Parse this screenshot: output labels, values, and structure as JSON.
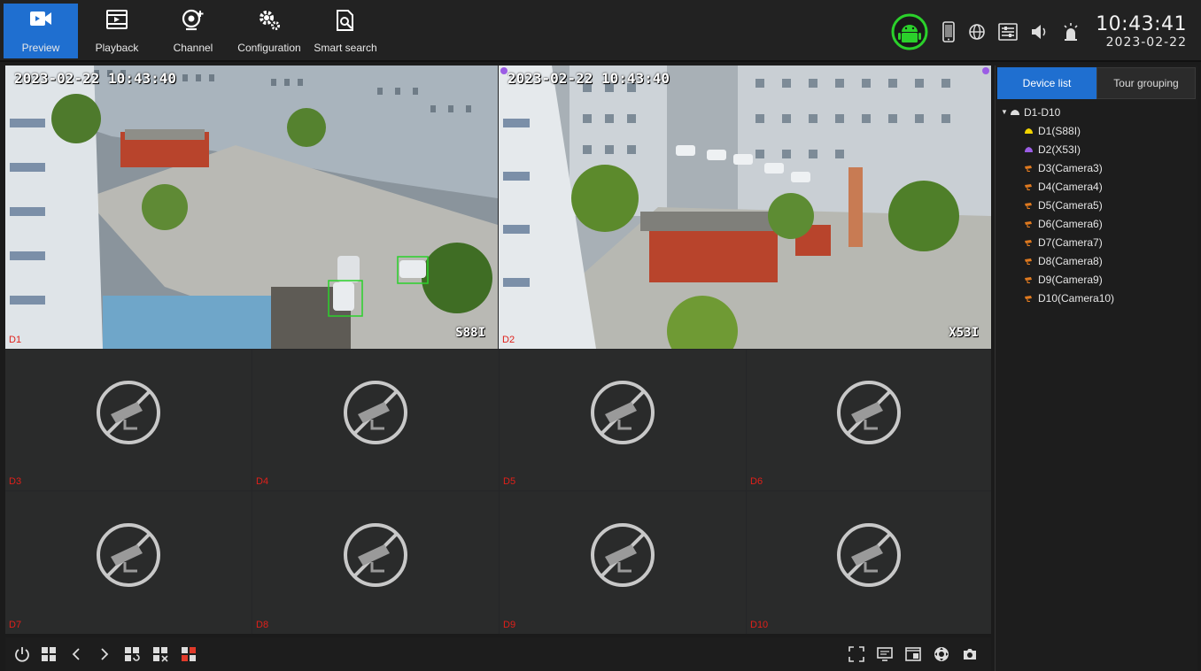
{
  "topnav": {
    "items": [
      {
        "label": "Preview",
        "icon": "camera-icon",
        "active": true
      },
      {
        "label": "Playback",
        "icon": "playback-icon",
        "active": false
      },
      {
        "label": "Channel",
        "icon": "add-channel-icon",
        "active": false
      },
      {
        "label": "Configuration",
        "icon": "gears-icon",
        "active": false
      },
      {
        "label": "Smart search",
        "icon": "smart-search-icon",
        "active": false
      }
    ]
  },
  "status": {
    "time": "10:43:41",
    "date": "2023-02-22",
    "icons": [
      "android-icon",
      "mobile-icon",
      "network-icon",
      "settings-panel-icon",
      "volume-icon",
      "alarm-icon"
    ]
  },
  "tiles": [
    {
      "channel": "D1",
      "osd_time": "2023-02-22 10:43:40",
      "osd_name": "S88I",
      "live": true
    },
    {
      "channel": "D2",
      "osd_time": "2023-02-22 10:43:40",
      "osd_name": "X53I",
      "live": true
    },
    {
      "channel": "D3",
      "live": false
    },
    {
      "channel": "D4",
      "live": false
    },
    {
      "channel": "D5",
      "live": false
    },
    {
      "channel": "D6",
      "live": false
    },
    {
      "channel": "D7",
      "live": false
    },
    {
      "channel": "D8",
      "live": false
    },
    {
      "channel": "D9",
      "live": false
    },
    {
      "channel": "D10",
      "live": false
    }
  ],
  "panel": {
    "tabs": [
      {
        "label": "Device list",
        "active": true
      },
      {
        "label": "Tour grouping",
        "active": false
      }
    ],
    "group": "D1-D10",
    "devices": [
      {
        "label": "D1(S88I)",
        "icon_color": "#f2d400"
      },
      {
        "label": "D2(X53I)",
        "icon_color": "#9b5de5"
      },
      {
        "label": "D3(Camera3)",
        "icon_color": "#e07a1f"
      },
      {
        "label": "D4(Camera4)",
        "icon_color": "#e07a1f"
      },
      {
        "label": "D5(Camera5)",
        "icon_color": "#e07a1f"
      },
      {
        "label": "D6(Camera6)",
        "icon_color": "#e07a1f"
      },
      {
        "label": "D7(Camera7)",
        "icon_color": "#e07a1f"
      },
      {
        "label": "D8(Camera8)",
        "icon_color": "#e07a1f"
      },
      {
        "label": "D9(Camera9)",
        "icon_color": "#e07a1f"
      },
      {
        "label": "D10(Camera10)",
        "icon_color": "#e07a1f"
      }
    ]
  },
  "toolbar": {
    "left_icons": [
      "power-icon",
      "layout-grid-icon",
      "previous-icon",
      "next-icon",
      "layout-switch-icon",
      "layout-custom-icon",
      "layout-quad-icon"
    ],
    "right_icons": [
      "fullscreen-icon",
      "display-icon",
      "window-icon",
      "ptz-icon",
      "snapshot-icon"
    ]
  },
  "colors": {
    "accent": "#1f6fd0",
    "channel_label": "#e0201a",
    "android_badge": "#2bd12b"
  }
}
